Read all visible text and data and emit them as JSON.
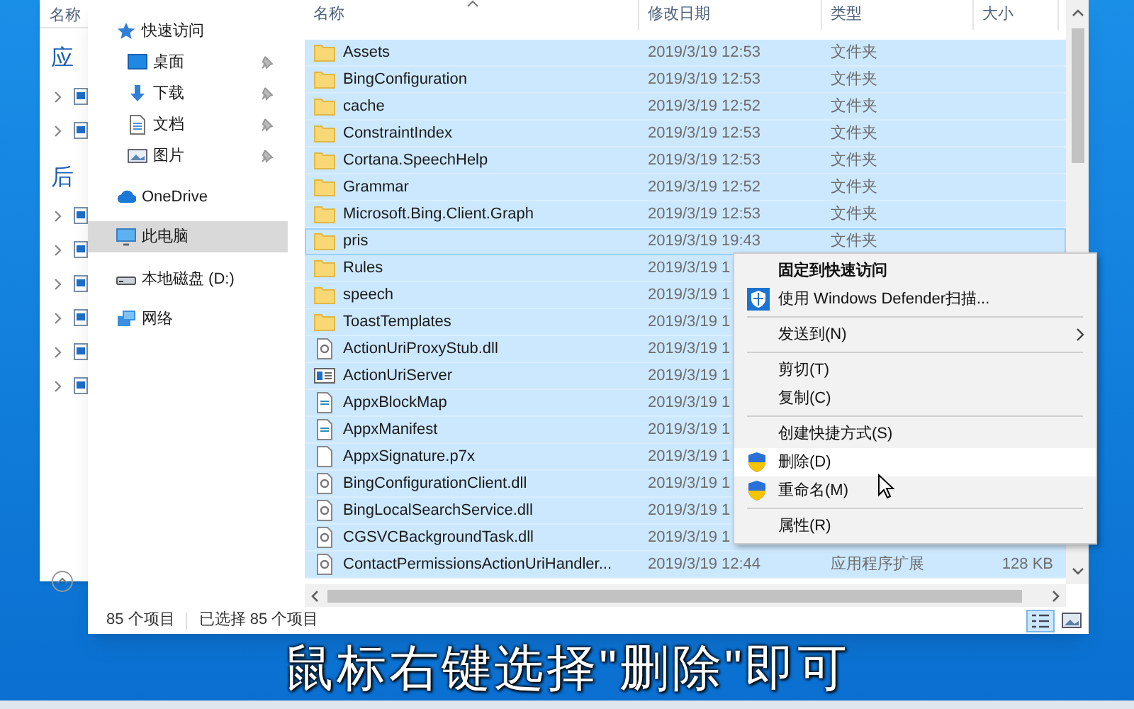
{
  "back_window": {
    "header": "名称",
    "groups": [
      "应",
      "后"
    ]
  },
  "nav": [
    {
      "label": "快速访问",
      "pinned": false,
      "selected": false
    },
    {
      "label": "桌面",
      "pinned": true,
      "selected": false
    },
    {
      "label": "下载",
      "pinned": true,
      "selected": false
    },
    {
      "label": "文档",
      "pinned": true,
      "selected": false
    },
    {
      "label": "图片",
      "pinned": true,
      "selected": false
    },
    {
      "label": "OneDrive",
      "pinned": false,
      "selected": false
    },
    {
      "label": "此电脑",
      "pinned": false,
      "selected": true
    },
    {
      "label": "本地磁盘 (D:)",
      "pinned": false,
      "selected": false
    },
    {
      "label": "网络",
      "pinned": false,
      "selected": false
    }
  ],
  "columns": [
    "名称",
    "修改日期",
    "类型",
    "大小"
  ],
  "rows": [
    {
      "kind": "folder",
      "name": "Assets",
      "date": "2019/3/19 12:53",
      "type": "文件夹",
      "size": "",
      "selected": true,
      "focused": false
    },
    {
      "kind": "folder",
      "name": "BingConfiguration",
      "date": "2019/3/19 12:53",
      "type": "文件夹",
      "size": "",
      "selected": true,
      "focused": false
    },
    {
      "kind": "folder",
      "name": "cache",
      "date": "2019/3/19 12:52",
      "type": "文件夹",
      "size": "",
      "selected": true,
      "focused": false
    },
    {
      "kind": "folder",
      "name": "ConstraintIndex",
      "date": "2019/3/19 12:53",
      "type": "文件夹",
      "size": "",
      "selected": true,
      "focused": false
    },
    {
      "kind": "folder",
      "name": "Cortana.SpeechHelp",
      "date": "2019/3/19 12:53",
      "type": "文件夹",
      "size": "",
      "selected": true,
      "focused": false
    },
    {
      "kind": "folder",
      "name": "Grammar",
      "date": "2019/3/19 12:52",
      "type": "文件夹",
      "size": "",
      "selected": true,
      "focused": false
    },
    {
      "kind": "folder",
      "name": "Microsoft.Bing.Client.Graph",
      "date": "2019/3/19 12:53",
      "type": "文件夹",
      "size": "",
      "selected": true,
      "focused": false
    },
    {
      "kind": "folder",
      "name": "pris",
      "date": "2019/3/19 19:43",
      "type": "文件夹",
      "size": "",
      "selected": true,
      "focused": true
    },
    {
      "kind": "folder",
      "name": "Rules",
      "date": "2019/3/19 1",
      "type": "",
      "size": "",
      "selected": true,
      "focused": false
    },
    {
      "kind": "folder",
      "name": "speech",
      "date": "2019/3/19 1",
      "type": "",
      "size": "",
      "selected": true,
      "focused": false
    },
    {
      "kind": "folder",
      "name": "ToastTemplates",
      "date": "2019/3/19 1",
      "type": "",
      "size": "",
      "selected": true,
      "focused": false
    },
    {
      "kind": "dll",
      "name": "ActionUriProxyStub.dll",
      "date": "2019/3/19 1",
      "type": "",
      "size": "",
      "selected": true,
      "focused": false
    },
    {
      "kind": "app",
      "name": "ActionUriServer",
      "date": "2019/3/19 1",
      "type": "",
      "size": "",
      "selected": true,
      "focused": false
    },
    {
      "kind": "xml",
      "name": "AppxBlockMap",
      "date": "2019/3/19 1",
      "type": "",
      "size": "",
      "selected": true,
      "focused": false
    },
    {
      "kind": "xml",
      "name": "AppxManifest",
      "date": "2019/3/19 1",
      "type": "",
      "size": "",
      "selected": true,
      "focused": false
    },
    {
      "kind": "file",
      "name": "AppxSignature.p7x",
      "date": "2019/3/19 1",
      "type": "",
      "size": "",
      "selected": true,
      "focused": false
    },
    {
      "kind": "dll",
      "name": "BingConfigurationClient.dll",
      "date": "2019/3/19 1",
      "type": "",
      "size": "",
      "selected": true,
      "focused": false
    },
    {
      "kind": "dll",
      "name": "BingLocalSearchService.dll",
      "date": "2019/3/19 1",
      "type": "",
      "size": "",
      "selected": true,
      "focused": false
    },
    {
      "kind": "dll",
      "name": "CGSVCBackgroundTask.dll",
      "date": "2019/3/19 1",
      "type": "",
      "size": "",
      "selected": true,
      "focused": false
    },
    {
      "kind": "dll",
      "name": "ContactPermissionsActionUriHandler...",
      "date": "2019/3/19 12:44",
      "type": "应用程序扩展",
      "size": "128 KB",
      "selected": true,
      "focused": false
    }
  ],
  "context_menu": [
    {
      "kind": "plain",
      "label": "固定到快速访问",
      "bold": true,
      "submenu": false,
      "highlighted": false
    },
    {
      "kind": "scan",
      "label": "使用 Windows Defender扫描...",
      "bold": false,
      "submenu": false,
      "highlighted": false
    },
    {
      "kind": "separator"
    },
    {
      "kind": "plain",
      "label": "发送到(N)",
      "bold": false,
      "submenu": true,
      "highlighted": false
    },
    {
      "kind": "separator"
    },
    {
      "kind": "plain",
      "label": "剪切(T)",
      "bold": false,
      "submenu": false,
      "highlighted": false
    },
    {
      "kind": "plain",
      "label": "复制(C)",
      "bold": false,
      "submenu": false,
      "highlighted": false
    },
    {
      "kind": "separator"
    },
    {
      "kind": "plain",
      "label": "创建快捷方式(S)",
      "bold": false,
      "submenu": false,
      "highlighted": false
    },
    {
      "kind": "elevated",
      "label": "删除(D)",
      "bold": false,
      "submenu": false,
      "highlighted": true
    },
    {
      "kind": "elevated",
      "label": "重命名(M)",
      "bold": false,
      "submenu": false,
      "highlighted": false
    },
    {
      "kind": "separator"
    },
    {
      "kind": "plain",
      "label": "属性(R)",
      "bold": false,
      "submenu": false,
      "highlighted": false
    }
  ],
  "status_bar": {
    "item_count": "85 个项目",
    "selected_count": "已选择 85 个项目"
  },
  "caption": "鼠标右键选择\"删除\"即可"
}
